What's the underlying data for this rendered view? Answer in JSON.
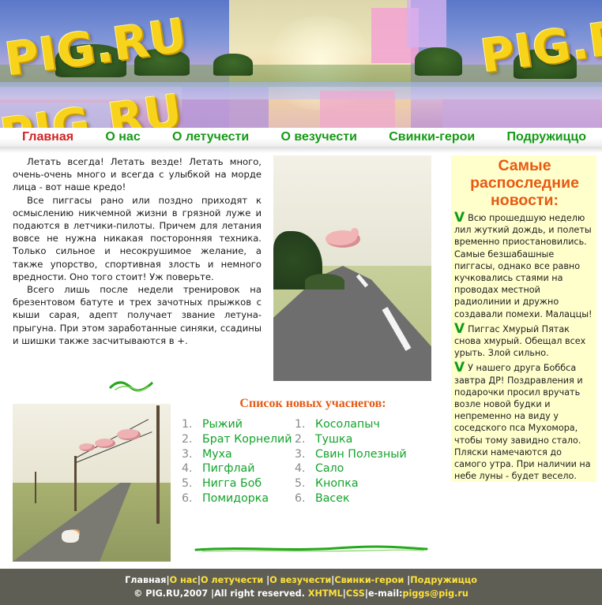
{
  "site": {
    "logo_text": "PIG.RU"
  },
  "nav": [
    {
      "label": "Главная",
      "active": true
    },
    {
      "label": "О нас",
      "active": false
    },
    {
      "label": "О летучести",
      "active": false
    },
    {
      "label": "О везучести",
      "active": false
    },
    {
      "label": "Свинки-герои",
      "active": false
    },
    {
      "label": "Подружиццо",
      "active": false
    }
  ],
  "intro": {
    "paragraphs": [
      "Летать всегда! Летать везде! Летать много, очень-очень много и всегда с улыбкой на морде лица - вот наше кредо!",
      "Все пиггасы рано или поздно приходят к осмыслению никчемной жизни в грязной луже и подаются в летчики-пилоты. Причем для летания вовсе не нужна никакая посторонняя техника. Только сильное и несокрушимое желание, а также упорство, спортивная злость и немного вредности. Оно того стоит! Уж поверьте.",
      "Всего лишь после недели тренировок на брезентовом батуте и трех зачотных прыжков с кыши сарая, адепт получает звание летуна-прыгуна. При этом заработанные синяки, ссадины и шишки также засчитываются в +."
    ]
  },
  "news": {
    "title": "Самые распоследние новости:",
    "check_glyph": "V",
    "items": [
      "Всю прошедшую неделю лил жуткий дождь, и полеты временно приостановились. Самые безшабашные пиггасы, однако все равно кучковались стаями на проводах местной радиолинии и дружно создавали помехи. Малаццы!",
      "Пиггас Хмурый Пятак снова хмурый. Обещал всех урыть. Злой сильно.",
      "У нашего друга Боббса завтра ДР! Поздравления и подарочки просил вручать возле новой будки и непременно на виду у соседского пса Мухомора, чтобы тому завидно стало. Пляски намечаются до самого утра. При наличии на небе луны - будет весело."
    ]
  },
  "members": {
    "title": "Список новых учаснегов:",
    "col1": [
      {
        "num": "1.",
        "name": "Рыжий"
      },
      {
        "num": "2.",
        "name": "Брат Корнелий"
      },
      {
        "num": "3.",
        "name": "Муха"
      },
      {
        "num": "4.",
        "name": "Пигфлай"
      },
      {
        "num": "5.",
        "name": "Нигга Боб"
      },
      {
        "num": "6.",
        "name": "Помидорка"
      }
    ],
    "col2": [
      {
        "num": "1.",
        "name": "Косолапыч"
      },
      {
        "num": "2.",
        "name": "Тушка"
      },
      {
        "num": "3.",
        "name": "Свин Полезный"
      },
      {
        "num": "4.",
        "name": "Сало"
      },
      {
        "num": "5.",
        "name": "Кнопка"
      },
      {
        "num": "6.",
        "name": "Васек"
      }
    ]
  },
  "footer": {
    "links": [
      "Главная",
      "О нас",
      "О летучести ",
      "О везучести",
      "Свинки-герои ",
      "Подружиццо"
    ],
    "copyright": "© PIG.RU,2007 |All right reserved.",
    "xhtml": "XHTML",
    "css": "CSS",
    "email_label": "e-mail:",
    "email": "piggs@pig.ru"
  },
  "colors": {
    "nav_link": "#149a14",
    "nav_active": "#d42222",
    "accent_orange": "#e35b14",
    "news_bg": "#ffffcc",
    "footer_bg": "#5e5e55",
    "footer_link": "#ffe23a"
  }
}
